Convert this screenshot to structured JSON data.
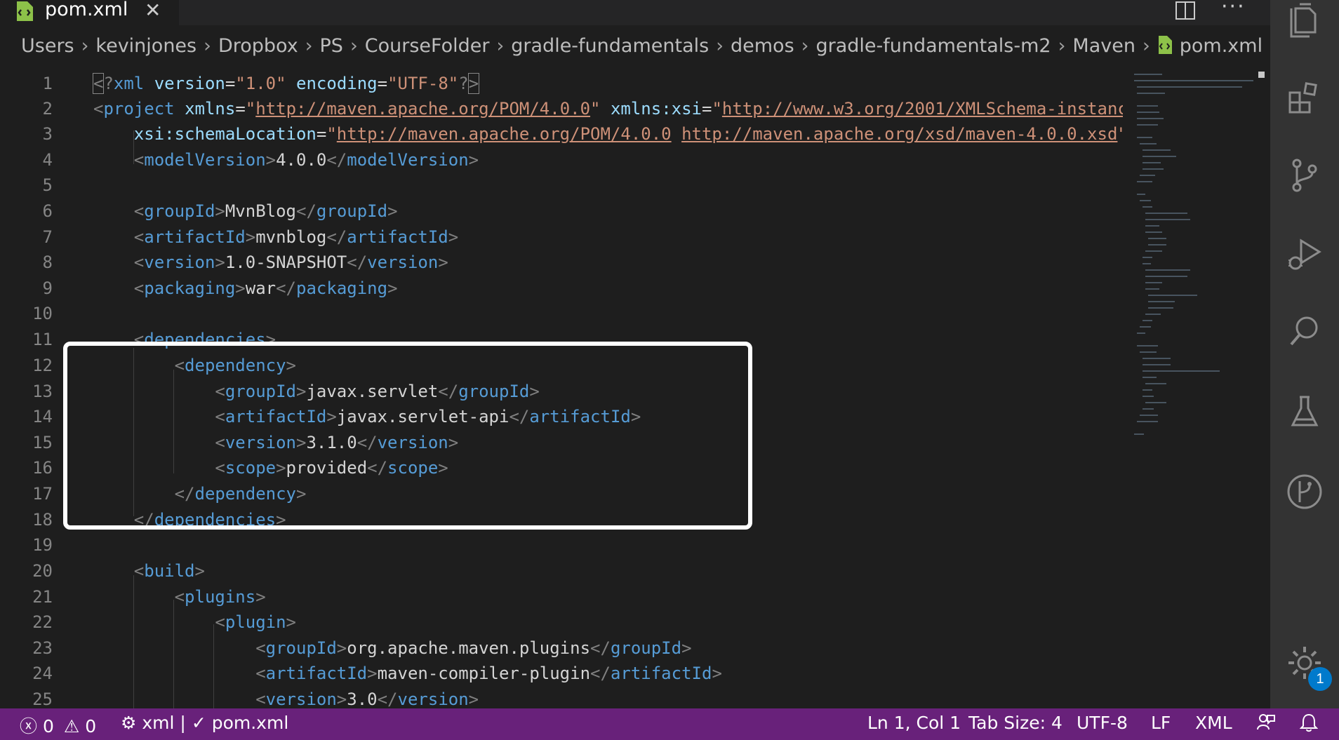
{
  "tab": {
    "name": "pom.xml"
  },
  "breadcrumb": [
    "Users",
    "kevinjones",
    "Dropbox",
    "PS",
    "CourseFolder",
    "gradle-fundamentals",
    "demos",
    "gradle-fundamentals-m2",
    "Maven",
    "pom.xml"
  ],
  "code": [
    {
      "n": "1"
    },
    {
      "n": "2"
    },
    {
      "n": "3"
    },
    {
      "n": "4"
    },
    {
      "n": "5"
    },
    {
      "n": "6"
    },
    {
      "n": "7"
    },
    {
      "n": "8"
    },
    {
      "n": "9"
    },
    {
      "n": "10"
    },
    {
      "n": "11"
    },
    {
      "n": "12"
    },
    {
      "n": "13"
    },
    {
      "n": "14"
    },
    {
      "n": "15"
    },
    {
      "n": "16"
    },
    {
      "n": "17"
    },
    {
      "n": "18"
    },
    {
      "n": "19"
    },
    {
      "n": "20"
    },
    {
      "n": "21"
    },
    {
      "n": "22"
    },
    {
      "n": "23"
    },
    {
      "n": "24"
    },
    {
      "n": "25"
    }
  ],
  "status": {
    "errors": "0",
    "warnings": "0",
    "language_mode": "xml",
    "file": "pom.xml",
    "position": "Ln 1, Col 1",
    "tab_size": "Tab Size: 4",
    "encoding": "UTF-8",
    "eol": "LF",
    "language": "XML",
    "notification_count": "1"
  },
  "colors": {
    "statusbar": "#68217a",
    "editor_bg": "#1e1e1e",
    "tag": "#569cd6",
    "attr": "#9cdcfe",
    "string": "#ce9178"
  },
  "icons": [
    "file-xml-icon",
    "close-icon",
    "split-editor-icon",
    "more-actions-icon",
    "explorer-icon",
    "extensions-icon",
    "source-control-icon",
    "run-debug-icon",
    "search-icon",
    "testing-icon",
    "timeline-icon",
    "settings-gear-icon",
    "errors-icon",
    "warnings-icon",
    "feedback-icon",
    "bell-icon"
  ]
}
